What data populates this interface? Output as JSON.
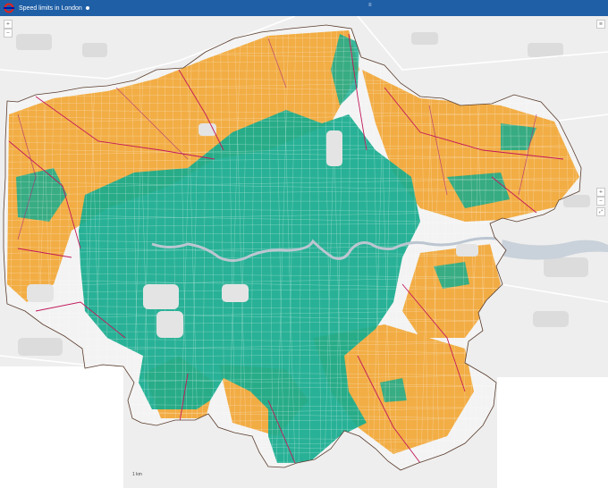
{
  "app": {
    "title": "Speed limits in London",
    "center_control": "≡"
  },
  "icons": {
    "logo": "roundel-icon",
    "zoom_in": "plus-icon",
    "zoom_out": "minus-icon",
    "layers": "layers-icon",
    "fullscreen": "fullscreen-icon"
  },
  "controls": {
    "left_zoom_in": "+",
    "left_zoom_out": "−",
    "right_zoom_in": "+",
    "right_zoom_out": "−",
    "scale_label": "1 km"
  },
  "colors": {
    "header": "#1f5fa6",
    "limit_20mph": "#17ab8e",
    "limit_30mph": "#f2a531",
    "limit_40mph": "#c2185b",
    "limit_50mph": "#b02a7a",
    "boundary": "#5a3c2c",
    "thames": "#bcc6d1",
    "basemap": "#eeeeee"
  }
}
